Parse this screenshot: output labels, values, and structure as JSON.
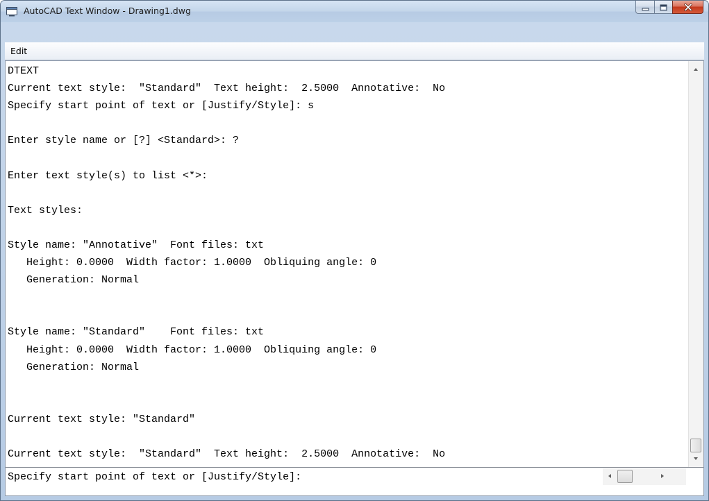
{
  "window": {
    "title": "AutoCAD Text Window - Drawing1.dwg",
    "app_icon": "autocad-window-icon",
    "caption_buttons": [
      "minimize-icon",
      "maximize-icon",
      "close-icon"
    ],
    "colors": {
      "frame": "#c3d5ea",
      "close_button": "#c4381c",
      "text_area": "#ffffff"
    }
  },
  "menu": {
    "edit_label": "Edit"
  },
  "history": {
    "lines": [
      "DTEXT",
      "Current text style:  \"Standard\"  Text height:  2.5000  Annotative:  No",
      "Specify start point of text or [Justify/Style]: s",
      "",
      "Enter style name or [?] <Standard>: ?",
      "",
      "Enter text style(s) to list <*>:",
      "",
      "Text styles:",
      "",
      "Style name: \"Annotative\"  Font files: txt",
      "   Height: 0.0000  Width factor: 1.0000  Obliquing angle: 0",
      "   Generation: Normal",
      "",
      "",
      "Style name: \"Standard\"    Font files: txt",
      "   Height: 0.0000  Width factor: 1.0000  Obliquing angle: 0",
      "   Generation: Normal",
      "",
      "",
      "Current text style: \"Standard\"",
      "",
      "Current text style:  \"Standard\"  Text height:  2.5000  Annotative:  No"
    ]
  },
  "command_line": {
    "prompt": "Specify start point of text or [Justify/Style]: "
  }
}
